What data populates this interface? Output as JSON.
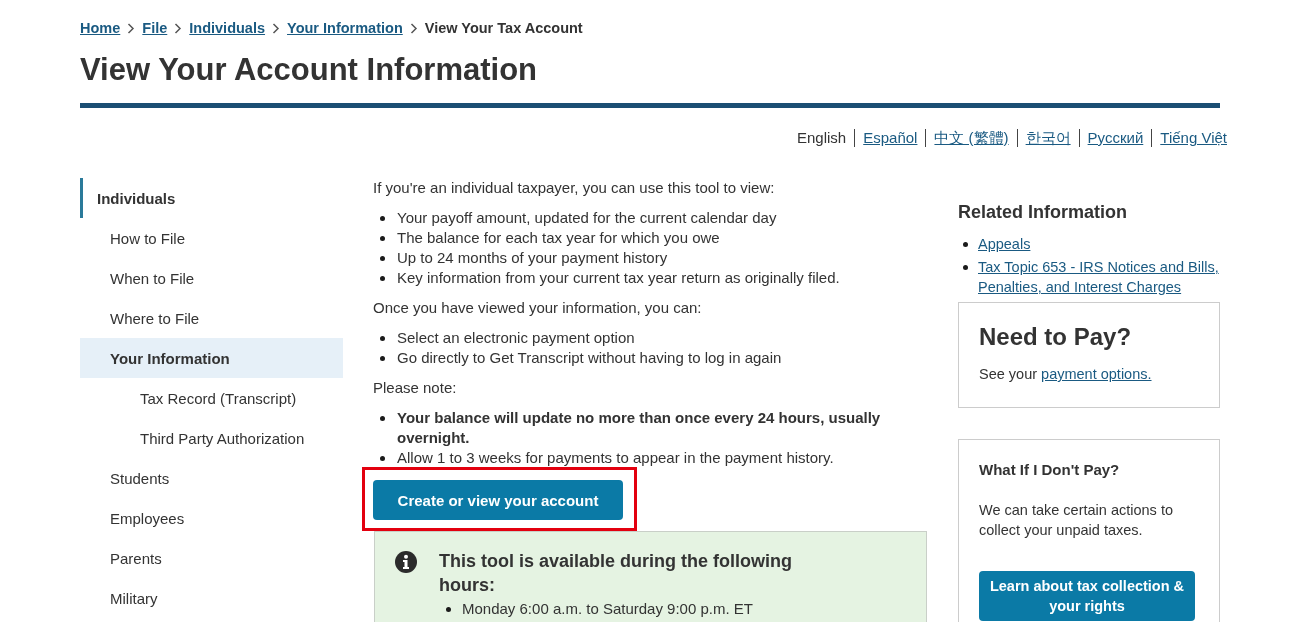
{
  "breadcrumb": [
    {
      "label": "Home",
      "kind": "link"
    },
    {
      "label": "File",
      "kind": "link"
    },
    {
      "label": "Individuals",
      "kind": "link"
    },
    {
      "label": "Your Information",
      "kind": "link"
    },
    {
      "label": "View Your Tax Account",
      "kind": "current"
    }
  ],
  "page_title": "View Your Account Information",
  "languages": [
    {
      "label": "English",
      "selected": true
    },
    {
      "label": "Español",
      "selected": false
    },
    {
      "label": "中文 (繁體)",
      "selected": false
    },
    {
      "label": "한국어",
      "selected": false
    },
    {
      "label": "Русский",
      "selected": false
    },
    {
      "label": "Tiếng Việt",
      "selected": false
    }
  ],
  "sidebar": {
    "title": "Individuals",
    "items": [
      {
        "label": "How to File",
        "selected": false
      },
      {
        "label": "When to File",
        "selected": false
      },
      {
        "label": "Where to File",
        "selected": false
      },
      {
        "label": "Your Information",
        "selected": true,
        "children": [
          {
            "label": "Tax Record (Transcript)",
            "selected": false
          },
          {
            "label": "Third Party Authorization",
            "selected": false
          }
        ]
      },
      {
        "label": "Students",
        "selected": false
      },
      {
        "label": "Employees",
        "selected": false
      },
      {
        "label": "Parents",
        "selected": false
      },
      {
        "label": "Military",
        "selected": false
      }
    ]
  },
  "main": {
    "sections": [
      {
        "intro": "If you're an individual taxpayer, you can use this tool to view:",
        "items": [
          {
            "text": "Your payoff amount, updated for the current calendar day",
            "bold": false
          },
          {
            "text": "The balance for each tax year for which you owe",
            "bold": false
          },
          {
            "text": "Up to 24 months of your payment history",
            "bold": false
          },
          {
            "text": "Key information from your current tax year return as originally filed.",
            "bold": false
          }
        ]
      },
      {
        "intro": "Once you have viewed your information, you can:",
        "items": [
          {
            "text": "Select an electronic payment option",
            "bold": false
          },
          {
            "text": "Go directly to Get Transcript without having to log in again",
            "bold": false
          }
        ]
      },
      {
        "intro": "Please note:",
        "items": [
          {
            "text": "Your balance will update no more than once every 24 hours, usually overnight.",
            "bold": true
          },
          {
            "text": "Allow 1 to 3 weeks for payments to appear in the payment history.",
            "bold": false
          }
        ]
      }
    ],
    "cta_button": {
      "label": "Create or view your account",
      "highlighted": true
    },
    "notice": {
      "kind": "info",
      "title": "This tool is available during the following hours:",
      "items": [
        "Monday 6:00 a.m. to Saturday 9:00 p.m. ET"
      ]
    }
  },
  "related": {
    "title": "Related Information",
    "links": [
      "Appeals",
      "Tax Topic 653 - IRS Notices and Bills, Penalties, and Interest Charges"
    ]
  },
  "pay_card": {
    "title": "Need to Pay?",
    "text": "See your",
    "link": "payment options."
  },
  "collection_card": {
    "title": "What If I Don't Pay?",
    "text": "We can take certain actions to collect your unpaid taxes.",
    "button": "Learn about tax collection & your rights"
  }
}
